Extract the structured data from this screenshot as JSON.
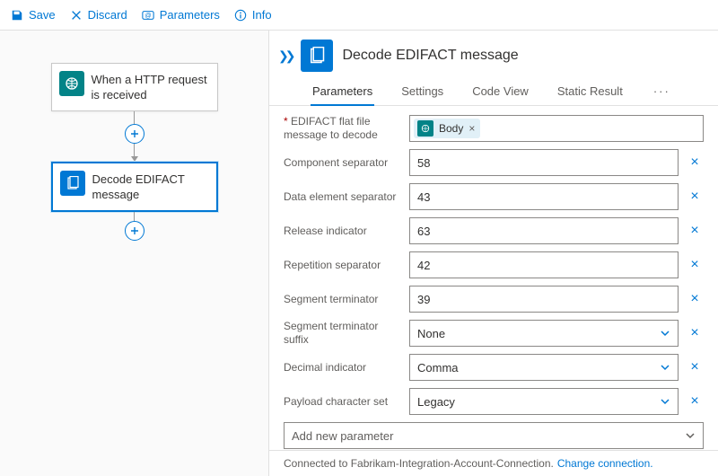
{
  "toolbar": {
    "save": "Save",
    "discard": "Discard",
    "parameters": "Parameters",
    "info": "Info"
  },
  "canvas": {
    "step1": "When a HTTP request is received",
    "step2": "Decode EDIFACT message"
  },
  "panel": {
    "title": "Decode EDIFACT message",
    "tabs": {
      "parameters": "Parameters",
      "settings": "Settings",
      "codeview": "Code View",
      "staticresult": "Static Result"
    }
  },
  "form": {
    "flatfile_label": "EDIFACT flat file message to decode",
    "flatfile_token": "Body",
    "component_sep_label": "Component separator",
    "component_sep_value": "58",
    "data_elem_sep_label": "Data element separator",
    "data_elem_sep_value": "43",
    "release_ind_label": "Release indicator",
    "release_ind_value": "63",
    "repetition_sep_label": "Repetition separator",
    "repetition_sep_value": "42",
    "segment_term_label": "Segment terminator",
    "segment_term_value": "39",
    "segment_term_suffix_label": "Segment terminator suffix",
    "segment_term_suffix_value": "None",
    "decimal_ind_label": "Decimal indicator",
    "decimal_ind_value": "Comma",
    "payload_charset_label": "Payload character set",
    "payload_charset_value": "Legacy",
    "add_new_param": "Add new parameter"
  },
  "footer": {
    "connected_to": "Connected to Fabrikam-Integration-Account-Connection.",
    "change": "Change connection."
  }
}
